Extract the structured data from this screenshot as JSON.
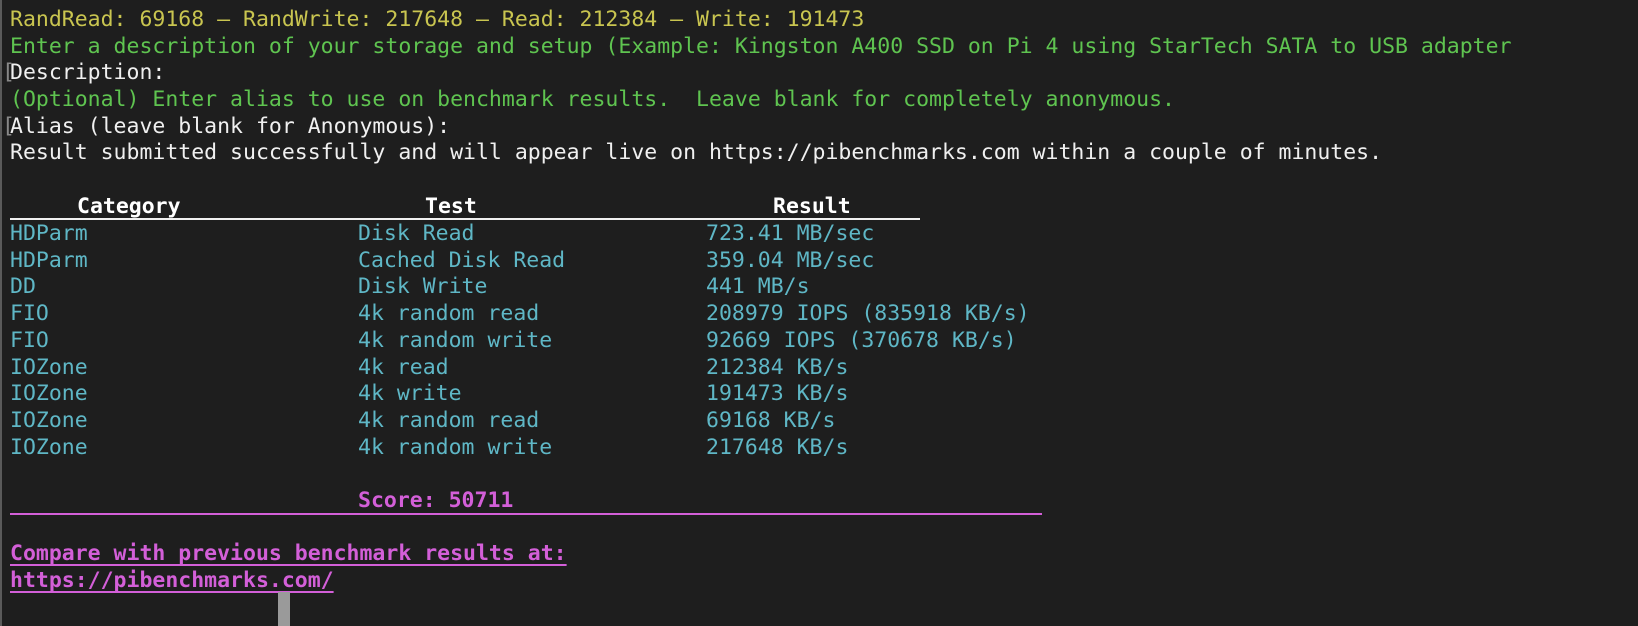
{
  "colors": {
    "background": "#1e1e1e",
    "summary": "#c9c550",
    "prompt": "#5fc450",
    "table": "#5fb7c6",
    "score": "#d35fd8"
  },
  "summary_line": "RandRead: 69168 – RandWrite: 217648 – Read: 212384 – Write: 191473",
  "description_prompt": "Enter a description of your storage and setup (Example: Kingston A400 SSD on Pi 4 using StarTech SATA to USB adapter",
  "description_label": "Description:",
  "alias_prompt": "(Optional) Enter alias to use on benchmark results.  Leave blank for completely anonymous.",
  "alias_label": "Alias (leave blank for Anonymous):",
  "submitted_message": "Result submitted successfully and will appear live on https://pibenchmarks.com within a couple of minutes.",
  "table": {
    "headers": [
      "Category",
      "Test",
      "Result"
    ],
    "rows": [
      [
        "HDParm",
        "Disk Read",
        "723.41 MB/sec"
      ],
      [
        "HDParm",
        "Cached Disk Read",
        "359.04 MB/sec"
      ],
      [
        "DD",
        "Disk Write",
        "441 MB/s"
      ],
      [
        "FIO",
        "4k random read",
        "208979 IOPS (835918 KB/s)"
      ],
      [
        "FIO",
        "4k random write",
        "92669 IOPS (370678 KB/s)"
      ],
      [
        "IOZone",
        "4k read",
        "212384 KB/s"
      ],
      [
        "IOZone",
        "4k write",
        "191473 KB/s"
      ],
      [
        "IOZone",
        "4k random read",
        "69168 KB/s"
      ],
      [
        "IOZone",
        "4k random write",
        "217648 KB/s"
      ]
    ]
  },
  "score": "Score: 50711",
  "compare_text": "Compare with previous benchmark results at:",
  "compare_link": "https://pibenchmarks.com/"
}
